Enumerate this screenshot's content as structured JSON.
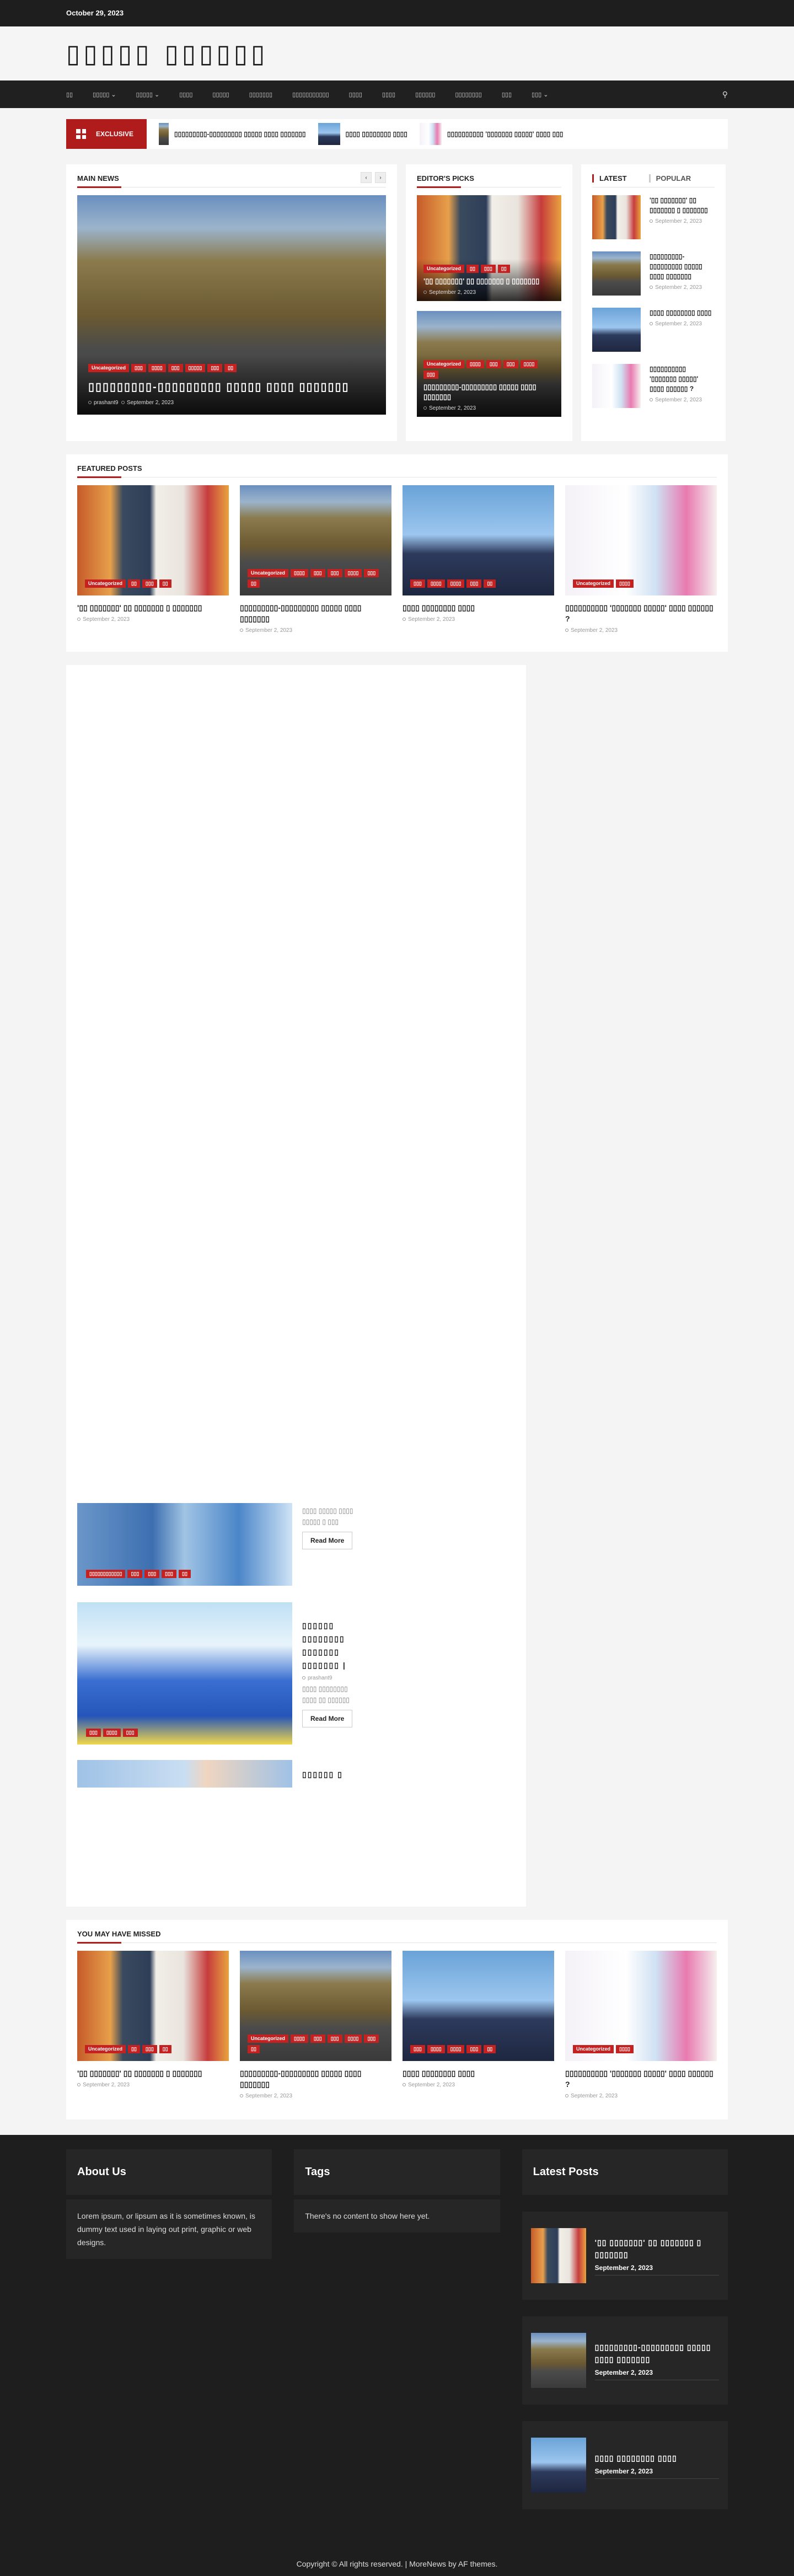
{
  "topbar": {
    "date": "October 29, 2023"
  },
  "site": {
    "title": "▯▯▯▯▯ ▯▯▯▯▯▯"
  },
  "nav": {
    "items": [
      "▯▯",
      "▯▯▯▯▯ ⌄",
      "▯▯▯▯▯ ⌄",
      "▯▯▯▯",
      "▯▯▯▯▯",
      "▯▯▯▯▯▯▯",
      "▯▯▯▯▯▯▯▯▯▯▯",
      "▯▯▯▯",
      "▯▯▯▯",
      "▯▯▯▯▯▯",
      "▯▯▯▯▯▯▯▯",
      "▯▯▯",
      "▯▯▯ ⌄"
    ],
    "search_icon": "search-icon"
  },
  "ticker": {
    "label": "EXCLUSIVE",
    "items": [
      "▯▯▯▯▯▯▯▯▯-▯▯▯▯▯▯▯▯▯ ▯▯▯▯▯ ▯▯▯▯ ▯▯▯▯▯▯▯",
      "▯▯▯▯ ▯▯▯▯▯▯▯▯ ▯▯▯▯",
      "▯▯▯▯▯▯▯▯▯▯ '▯▯▯▯▯▯▯ ▯▯▯▯▯' ▯▯▯▯ ▯▯▯"
    ]
  },
  "main_news": {
    "title": "MAIN NEWS",
    "prev": "‹",
    "next": "›",
    "categories": [
      "Uncategorized",
      "▯▯▯",
      "▯▯▯▯",
      "▯▯▯",
      "▯▯▯▯▯",
      "▯▯▯",
      "▯▯"
    ],
    "headline": "▯▯▯▯▯▯▯▯▯-▯▯▯▯▯▯▯▯▯ ▯▯▯▯▯ ▯▯▯▯ ▯▯▯▯▯▯▯",
    "author": "prashant9",
    "date": "September 2, 2023"
  },
  "editors_picks": {
    "title": "EDITOR'S PICKS",
    "items": [
      {
        "categories": [
          "Uncategorized",
          "▯▯",
          "▯▯▯",
          "▯▯"
        ],
        "title": "'▯▯ ▯▯▯▯▯▯▯' ▯▯ ▯▯▯▯▯▯▯ ▯ ▯▯▯▯▯▯▯",
        "date": "September 2, 2023"
      },
      {
        "categories": [
          "Uncategorized",
          "▯▯▯▯",
          "▯▯▯",
          "▯▯▯",
          "▯▯▯▯",
          "▯▯▯"
        ],
        "title": "▯▯▯▯▯▯▯▯▯-▯▯▯▯▯▯▯▯▯ ▯▯▯▯▯ ▯▯▯▯ ▯▯▯▯▯▯▯",
        "date": "September 2, 2023"
      }
    ]
  },
  "latest": {
    "tab_latest": "LATEST",
    "tab_popular": "POPULAR",
    "items": [
      {
        "title": "'▯▯ ▯▯▯▯▯▯▯' ▯▯ ▯▯▯▯▯▯▯ ▯ ▯▯▯▯▯▯▯",
        "date": "September 2, 2023"
      },
      {
        "title": "▯▯▯▯▯▯▯▯▯-▯▯▯▯▯▯▯▯▯ ▯▯▯▯▯ ▯▯▯▯ ▯▯▯▯▯▯▯",
        "date": "September 2, 2023"
      },
      {
        "title": "▯▯▯▯ ▯▯▯▯▯▯▯▯ ▯▯▯▯",
        "date": "September 2, 2023"
      },
      {
        "title": "▯▯▯▯▯▯▯▯▯▯ '▯▯▯▯▯▯▯ ▯▯▯▯▯' ▯▯▯▯ ▯▯▯▯▯▯ ?",
        "date": "September 2, 2023"
      }
    ]
  },
  "featured": {
    "title": "FEATURED POSTS",
    "items": [
      {
        "categories": [
          "Uncategorized",
          "▯▯",
          "▯▯▯",
          "▯▯"
        ],
        "title": "'▯▯ ▯▯▯▯▯▯▯' ▯▯ ▯▯▯▯▯▯▯ ▯ ▯▯▯▯▯▯▯",
        "date": "September 2, 2023"
      },
      {
        "categories": [
          "Uncategorized",
          "▯▯▯▯",
          "▯▯▯",
          "▯▯▯",
          "▯▯▯▯",
          "▯▯▯",
          "▯▯"
        ],
        "title": "▯▯▯▯▯▯▯▯▯-▯▯▯▯▯▯▯▯▯ ▯▯▯▯▯ ▯▯▯▯ ▯▯▯▯▯▯▯",
        "date": "September 2, 2023"
      },
      {
        "categories": [
          "▯▯▯",
          "▯▯▯▯",
          "▯▯▯▯",
          "▯▯▯",
          "▯▯"
        ],
        "title": "▯▯▯▯ ▯▯▯▯▯▯▯▯ ▯▯▯▯",
        "date": "September 2, 2023"
      },
      {
        "categories": [
          "Uncategorized",
          "▯▯▯▯"
        ],
        "title": "▯▯▯▯▯▯▯▯▯▯ '▯▯▯▯▯▯▯ ▯▯▯▯▯' ▯▯▯▯ ▯▯▯▯▯▯ ?",
        "date": "September 2, 2023"
      }
    ]
  },
  "list": {
    "items": [
      {
        "categories": [
          "▯▯▯▯▯▯▯▯▯▯▯▯",
          "▯▯▯",
          "▯▯▯",
          "▯▯▯",
          "▯▯"
        ],
        "title": "",
        "excerpt": "▯▯▯▯ ▯▯▯▯▯ ▯▯▯▯ ▯▯▯▯▯ ▯ ▯▯▯",
        "read_more": "Read More"
      },
      {
        "categories": [
          "▯▯▯",
          "▯▯▯▯",
          "▯▯▯"
        ],
        "title": "▯▯▯▯▯▯ ▯▯▯▯▯▯▯▯ ▯▯▯▯▯▯▯ ▯▯▯▯▯▯▯ |",
        "author": "prashant9",
        "excerpt": "▯▯▯▯ ▯▯▯▯▯▯▯▯ ▯▯▯▯ ▯▯ ▯▯▯▯▯▯",
        "read_more": "Read More"
      },
      {
        "categories": [],
        "title": "▯▯▯▯▯▯ ▯",
        "excerpt": "",
        "read_more": ""
      }
    ]
  },
  "missed": {
    "title": "YOU MAY HAVE MISSED",
    "items": [
      {
        "categories": [
          "Uncategorized",
          "▯▯",
          "▯▯▯",
          "▯▯"
        ],
        "title": "'▯▯ ▯▯▯▯▯▯▯' ▯▯ ▯▯▯▯▯▯▯ ▯ ▯▯▯▯▯▯▯",
        "date": "September 2, 2023"
      },
      {
        "categories": [
          "Uncategorized",
          "▯▯▯▯",
          "▯▯▯",
          "▯▯▯",
          "▯▯▯▯",
          "▯▯▯",
          "▯▯"
        ],
        "title": "▯▯▯▯▯▯▯▯▯-▯▯▯▯▯▯▯▯▯ ▯▯▯▯▯ ▯▯▯▯ ▯▯▯▯▯▯▯",
        "date": "September 2, 2023"
      },
      {
        "categories": [
          "▯▯▯",
          "▯▯▯▯",
          "▯▯▯▯",
          "▯▯▯",
          "▯▯"
        ],
        "title": "▯▯▯▯ ▯▯▯▯▯▯▯▯ ▯▯▯▯",
        "date": "September 2, 2023"
      },
      {
        "categories": [
          "Uncategorized",
          "▯▯▯▯"
        ],
        "title": "▯▯▯▯▯▯▯▯▯▯ '▯▯▯▯▯▯▯ ▯▯▯▯▯' ▯▯▯▯ ▯▯▯▯▯▯ ?",
        "date": "September 2, 2023"
      }
    ]
  },
  "footer": {
    "about_title": "About Us",
    "about_text": "Lorem ipsum, or lipsum as it is sometimes known, is dummy text used in laying out print, graphic or web designs.",
    "tags_title": "Tags",
    "tags_text": "There's no content to show here yet.",
    "latest_title": "Latest Posts",
    "latest_items": [
      {
        "title": "'▯▯ ▯▯▯▯▯▯▯' ▯▯ ▯▯▯▯▯▯▯ ▯ ▯▯▯▯▯▯▯",
        "date": "September 2, 2023"
      },
      {
        "title": "▯▯▯▯▯▯▯▯▯-▯▯▯▯▯▯▯▯▯ ▯▯▯▯▯ ▯▯▯▯ ▯▯▯▯▯▯▯",
        "date": "September 2, 2023"
      },
      {
        "title": "▯▯▯▯ ▯▯▯▯▯▯▯▯ ▯▯▯▯",
        "date": "September 2, 2023"
      }
    ],
    "copyright": "Copyright © All rights reserved. | MoreNews by AF themes."
  },
  "colors": {
    "accent": "#c62121",
    "dark": "#1e1e1e",
    "page_bg": "#f4f4f4"
  }
}
